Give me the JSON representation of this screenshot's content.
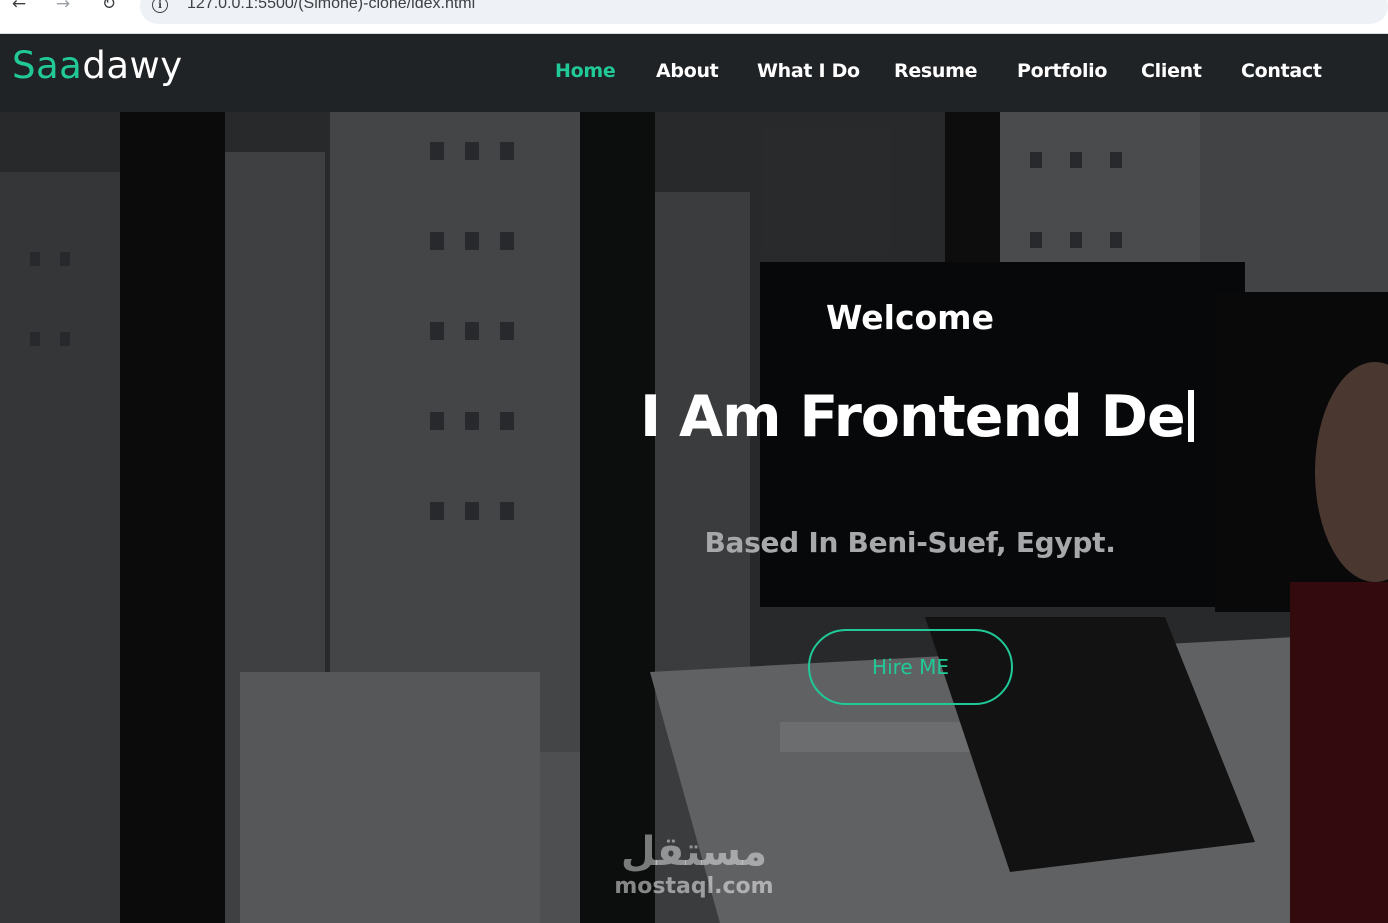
{
  "browser": {
    "url": "127.0.0.1:5500/(Simone)-clone/idex.html",
    "back_icon": "arrow-left-icon",
    "forward_icon": "arrow-right-icon",
    "reload_icon": "reload-icon",
    "info_icon": "info-icon"
  },
  "header": {
    "logo": {
      "part_a": "Saa",
      "part_b": "dawy"
    },
    "nav": [
      {
        "label": "Home",
        "active": true
      },
      {
        "label": "About",
        "active": false
      },
      {
        "label": "What I Do",
        "active": false
      },
      {
        "label": "Resume",
        "active": false
      },
      {
        "label": "Portfolio",
        "active": false
      },
      {
        "label": "Client",
        "active": false
      },
      {
        "label": "Contact",
        "active": false
      }
    ]
  },
  "hero": {
    "welcome": "Welcome",
    "headline": "I Am Frontend De",
    "location": "Based In Beni-Suef, Egypt.",
    "cta": "Hire ME"
  },
  "watermark": {
    "arabic": "مستقل",
    "latin": "mostaql.com"
  },
  "colors": {
    "accent": "#20c997",
    "header_bg": "#1f2326",
    "text": "#ffffff",
    "muted": "#a6a8aa"
  }
}
